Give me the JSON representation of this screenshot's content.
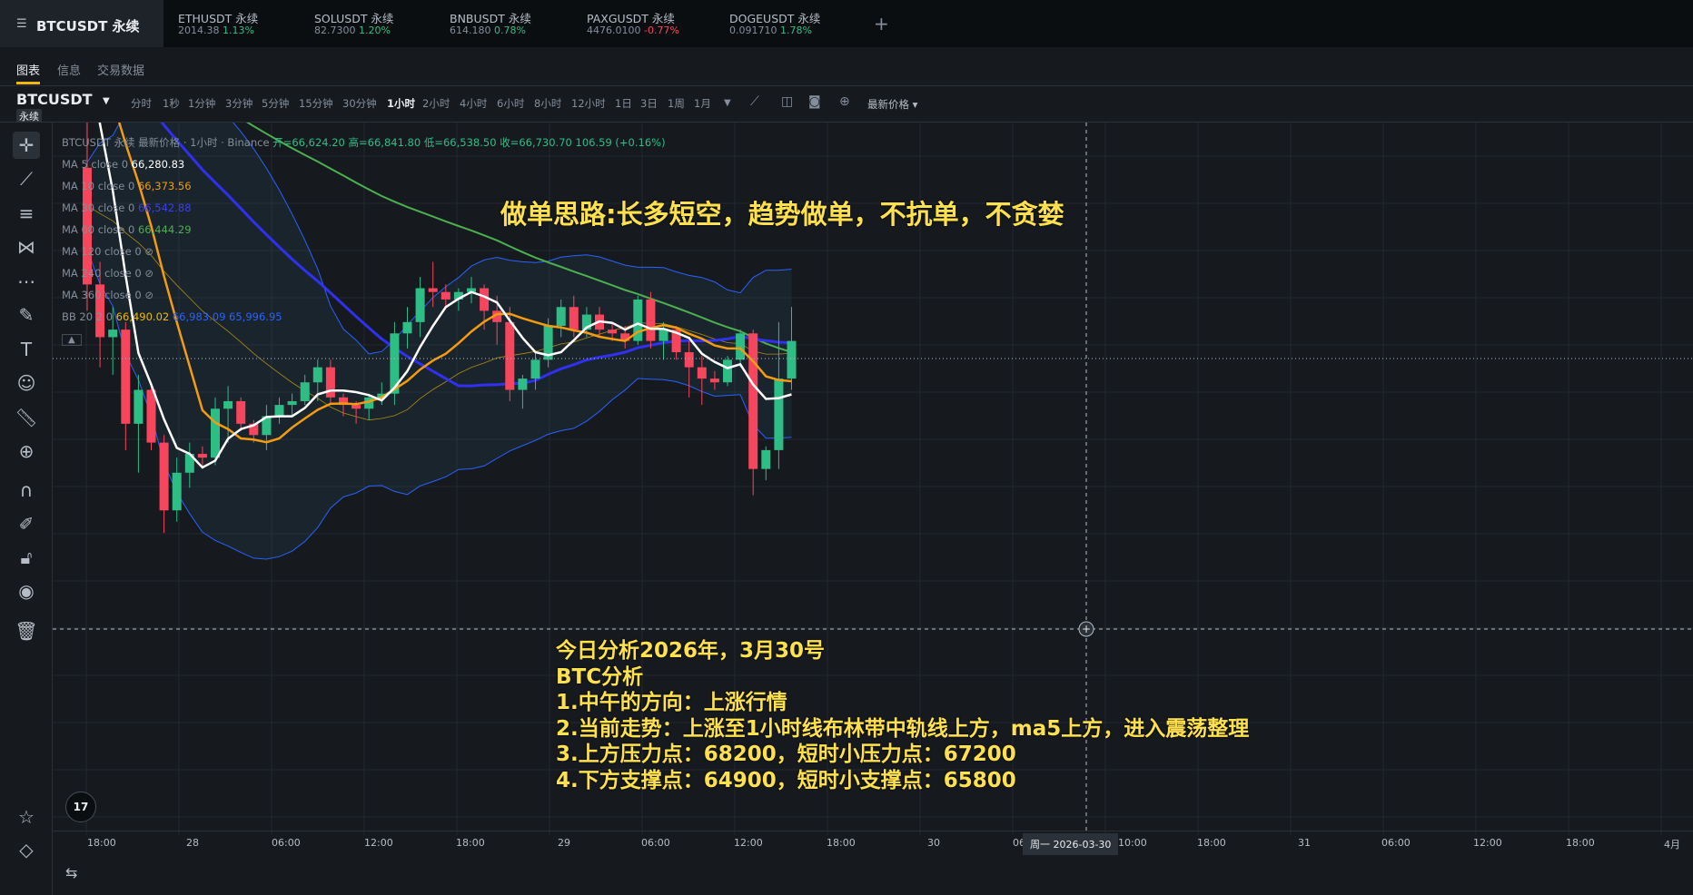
{
  "tabs": [
    {
      "symbol": "BTCUSDT 永续",
      "active": true
    },
    {
      "symbol": "ETHUSDT 永续",
      "price": "2014.38",
      "change": "1.13%",
      "dir": "up"
    },
    {
      "symbol": "SOLUSDT 永续",
      "price": "82.7300",
      "change": "1.20%",
      "dir": "up"
    },
    {
      "symbol": "BNBUSDT 永续",
      "price": "614.180",
      "change": "0.78%",
      "dir": "up"
    },
    {
      "symbol": "PAXGUSDT 永续",
      "price": "4476.0100",
      "change": "-0.77%",
      "dir": "down"
    },
    {
      "symbol": "DOGEUSDT 永续",
      "price": "0.091710",
      "change": "1.78%",
      "dir": "up"
    }
  ],
  "add_tab": "+",
  "subtabs": [
    "图表",
    "信息",
    "交易数据"
  ],
  "symbol": {
    "name": "BTCUSDT",
    "badge": "永续"
  },
  "intervals": [
    "分时",
    "1秒",
    "1分钟",
    "3分钟",
    "5分钟",
    "15分钟",
    "30分钟",
    "1小时",
    "2小时",
    "4小时",
    "6小时",
    "8小时",
    "12小时",
    "1日",
    "3日",
    "1周",
    "1月"
  ],
  "active_interval": "1小时",
  "price_type": "最新价格 ▾",
  "legend": {
    "title": "BTCUSDT 永续 最新价格 · 1小时 · Binance",
    "open": "开=66,624.20",
    "high": "高=66,841.80",
    "low": "低=66,538.50",
    "close": "收=66,730.70",
    "change": "106.59 (+0.16%)",
    "mas": [
      {
        "label": "MA 5 close 0",
        "value": "66,280.83",
        "color": "#ffffff"
      },
      {
        "label": "MA 10 close 0",
        "value": "66,373.56",
        "color": "#f39c12"
      },
      {
        "label": "MA 30 close 0",
        "value": "66,542.88",
        "color": "#3d3df5"
      },
      {
        "label": "MA 60 close 0",
        "value": "66,444.29",
        "color": "#4caf50"
      },
      {
        "label": "MA 120 close 0",
        "value": "",
        "color": "#848e9c"
      },
      {
        "label": "MA 240 close 0",
        "value": "",
        "color": "#848e9c"
      },
      {
        "label": "MA 360 close 0",
        "value": "",
        "color": "#848e9c"
      }
    ],
    "bb": {
      "label": "BB 20 2 0",
      "mid": "66,490.02",
      "upper": "66,983.09",
      "lower": "65,996.95"
    }
  },
  "overlay": {
    "strategy": "做单思路:长多短空，趋势做单，不抗单，不贪婪",
    "analysis": [
      "今日分析2026年，3月30号",
      "BTC分析",
      "1.中午的方向：上涨行情",
      "2.当前走势：上涨至1小时线布林带中轨线上方，ma5上方，进入震荡整理",
      "3.上方压力点：68200，短时小压力点：67200",
      "4.下方支撑点：64900，短时小支撑点：65800"
    ]
  },
  "time_axis": [
    "18:00",
    "28",
    "06:00",
    "12:00",
    "18:00",
    "29",
    "06:00",
    "12:00",
    "18:00",
    "30",
    "06",
    "10:00",
    "18:00",
    "31",
    "06:00",
    "12:00",
    "18:00",
    "4月"
  ],
  "crosshair_time": "周一 2026-03-30",
  "logo": "17",
  "colors": {
    "up": "#2ebd85",
    "down": "#f6465d",
    "accent": "#f0b90b",
    "text_overlay": "#ffe14d"
  },
  "chart_data": {
    "type": "candlestick",
    "candles": [
      [
        66930,
        67050,
        66550,
        66620
      ],
      [
        66620,
        66680,
        66400,
        66480
      ],
      [
        66480,
        66560,
        66380,
        66500
      ],
      [
        66500,
        66520,
        66180,
        66250
      ],
      [
        66250,
        66380,
        66120,
        66340
      ],
      [
        66340,
        66350,
        66180,
        66200
      ],
      [
        66200,
        66220,
        65960,
        66020
      ],
      [
        66020,
        66160,
        65990,
        66120
      ],
      [
        66120,
        66200,
        66080,
        66170
      ],
      [
        66170,
        66190,
        66130,
        66160
      ],
      [
        66160,
        66320,
        66140,
        66290
      ],
      [
        66290,
        66350,
        66200,
        66310
      ],
      [
        66310,
        66320,
        66230,
        66250
      ],
      [
        66250,
        66260,
        66200,
        66220
      ],
      [
        66220,
        66300,
        66180,
        66270
      ],
      [
        66270,
        66320,
        66250,
        66300
      ],
      [
        66300,
        66330,
        66270,
        66310
      ],
      [
        66310,
        66380,
        66300,
        66360
      ],
      [
        66360,
        66420,
        66310,
        66400
      ],
      [
        66400,
        66420,
        66300,
        66320
      ],
      [
        66320,
        66330,
        66270,
        66300
      ],
      [
        66300,
        66310,
        66250,
        66290
      ],
      [
        66290,
        66330,
        66260,
        66320
      ],
      [
        66320,
        66360,
        66300,
        66330
      ],
      [
        66330,
        66520,
        66300,
        66490
      ],
      [
        66490,
        66560,
        66450,
        66520
      ],
      [
        66520,
        66640,
        66480,
        66610
      ],
      [
        66610,
        66680,
        66560,
        66600
      ],
      [
        66600,
        66620,
        66560,
        66580
      ],
      [
        66580,
        66610,
        66550,
        66600
      ],
      [
        66600,
        66640,
        66570,
        66610
      ],
      [
        66610,
        66620,
        66500,
        66550
      ],
      [
        66550,
        66590,
        66460,
        66520
      ],
      [
        66520,
        66560,
        66310,
        66340
      ],
      [
        66340,
        66380,
        66290,
        66370
      ],
      [
        66370,
        66440,
        66340,
        66420
      ],
      [
        66420,
        66530,
        66400,
        66510
      ],
      [
        66510,
        66580,
        66480,
        66560
      ],
      [
        66560,
        66590,
        66480,
        66500
      ],
      [
        66500,
        66560,
        66480,
        66540
      ],
      [
        66540,
        66560,
        66480,
        66500
      ],
      [
        66500,
        66520,
        66470,
        66490
      ],
      [
        66490,
        66510,
        66450,
        66470
      ],
      [
        66470,
        66590,
        66460,
        66580
      ],
      [
        66580,
        66600,
        66450,
        66470
      ],
      [
        66470,
        66520,
        66420,
        66500
      ],
      [
        66500,
        66510,
        66420,
        66440
      ],
      [
        66440,
        66470,
        66320,
        66400
      ],
      [
        66400,
        66430,
        66300,
        66370
      ],
      [
        66370,
        66390,
        66340,
        66360
      ],
      [
        66360,
        66430,
        66350,
        66420
      ],
      [
        66420,
        66500,
        66400,
        66490
      ],
      [
        66490,
        66500,
        66060,
        66130
      ],
      [
        66130,
        66190,
        66100,
        66180
      ],
      [
        66180,
        66520,
        66130,
        66370
      ],
      [
        66370,
        66560,
        66340,
        66470
      ]
    ]
  }
}
